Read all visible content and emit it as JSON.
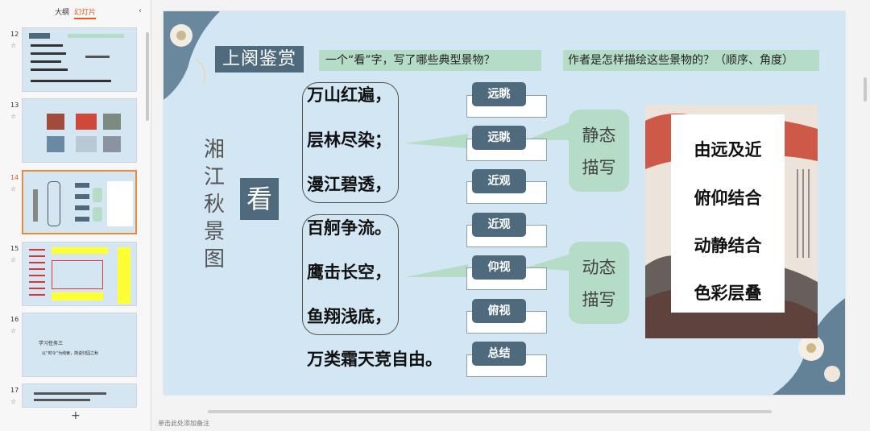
{
  "sidebar": {
    "tab_outline": "大纲",
    "tab_slides": "幻灯片",
    "collapse_icon": "chevron-left-icon",
    "slides": [
      {
        "num": "12",
        "active": false
      },
      {
        "num": "13",
        "active": false
      },
      {
        "num": "14",
        "active": true
      },
      {
        "num": "15",
        "active": false
      },
      {
        "num": "16",
        "active": false,
        "text1": "学习任务三",
        "text2": "以“时令”为线索，简说归园之秋"
      },
      {
        "num": "17",
        "active": false
      }
    ],
    "star": "☆",
    "add": "+"
  },
  "slide": {
    "section_title": "上阕鉴赏",
    "question1": "一个“看”字，写了哪些典型景物？",
    "question2": "作者是怎样描绘这些景物的？（顺序、角度）",
    "vertical_title": [
      "湘",
      "江",
      "秋",
      "景",
      "图"
    ],
    "kan": "看",
    "lines": [
      "万山红遍，",
      "层林尽染；",
      "漫江碧透，",
      "百舸争流。",
      "鹰击长空，",
      "鱼翔浅底，",
      "万类霜天竞自由。"
    ],
    "tags": [
      "远眺",
      "远眺",
      "近观",
      "近观",
      "仰视",
      "俯视",
      "总结"
    ],
    "groups": [
      {
        "line1": "静态",
        "line2": "描写"
      },
      {
        "line1": "动态",
        "line2": "描写"
      }
    ],
    "summary": [
      "由远及近",
      "俯仰结合",
      "动静结合",
      "色彩层叠"
    ]
  },
  "notes_placeholder": "单击此处添加备注",
  "colors": {
    "tag": "#4f6a7c",
    "green": "#b4dcc7",
    "slide_bg": "#d3e6f3",
    "accent": "#e05a24"
  }
}
